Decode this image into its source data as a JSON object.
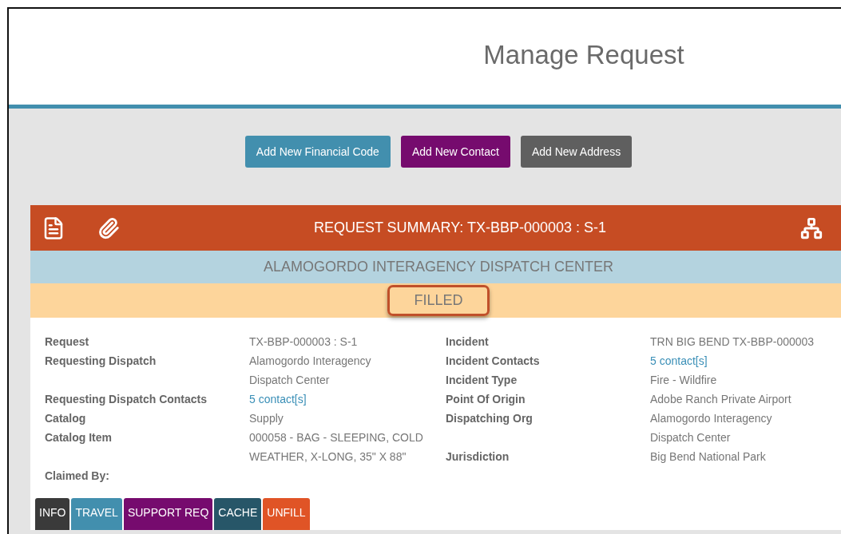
{
  "page_title": "Manage Request",
  "actions": [
    {
      "label": "Add New Financial Code",
      "color": "#428fae"
    },
    {
      "label": "Add New Contact",
      "color": "#760b6e"
    },
    {
      "label": "Add New Address",
      "color": "#5f5f5f"
    }
  ],
  "summary": {
    "title": "REQUEST SUMMARY: TX-BBP-000003 : S-1",
    "dispatch_center": "ALAMOGORDO INTERAGENCY DISPATCH CENTER",
    "status": "FILLED",
    "left": [
      {
        "label": "Request",
        "value": "TX-BBP-000003 : S-1",
        "kind": "text"
      },
      {
        "label": "Requesting Dispatch",
        "value": "Alamogordo Interagency\nDispatch Center",
        "kind": "text"
      },
      {
        "label": "Requesting Dispatch Contacts",
        "value": "5 contact[s]",
        "kind": "link"
      },
      {
        "label": "Catalog",
        "value": "Supply",
        "kind": "text"
      },
      {
        "label": "Catalog Item",
        "value": "000058 - BAG - SLEEPING, COLD\nWEATHER, X-LONG, 35\" X 88\"",
        "kind": "text"
      },
      {
        "label": "Claimed By:",
        "kind": "empty"
      }
    ],
    "right": [
      {
        "label": "Incident",
        "value": "TRN BIG BEND TX-BBP-000003",
        "kind": "text"
      },
      {
        "label": "Incident Contacts",
        "value": "5 contact[s]",
        "kind": "link"
      },
      {
        "label": "Incident Type",
        "value": "Fire - Wildfire",
        "kind": "text"
      },
      {
        "label": "Point Of Origin",
        "value": "Adobe Ranch Private Airport",
        "kind": "text"
      },
      {
        "label": "Dispatching Org",
        "value": "Alamogordo Interagency\nDispatch Center",
        "kind": "text"
      },
      {
        "label": "Jurisdiction",
        "value": "Big Bend National Park",
        "kind": "text"
      }
    ],
    "tabs": [
      {
        "label": "INFO",
        "color": "#3a3a3a"
      },
      {
        "label": "TRAVEL",
        "color": "#428fae"
      },
      {
        "label": "SUPPORT REQ",
        "color": "#760b6e"
      },
      {
        "label": "CACHE",
        "color": "#275668"
      },
      {
        "label": "UNFILL",
        "color": "#e05426"
      }
    ]
  }
}
